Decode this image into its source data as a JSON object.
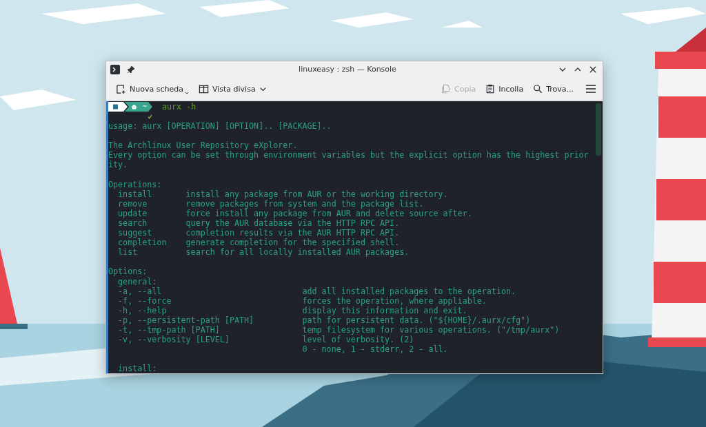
{
  "window": {
    "title": "linuxeasy : zsh — Konsole"
  },
  "toolbar": {
    "left": [
      {
        "label": "Nuova scheda",
        "kind": "newtab",
        "disabled": false
      },
      {
        "label": "Vista divisa",
        "kind": "split",
        "disabled": false
      }
    ],
    "right": [
      {
        "label": "Copia",
        "kind": "copy",
        "disabled": true
      },
      {
        "label": "Incolla",
        "kind": "paste",
        "disabled": false
      },
      {
        "label": "Trova...",
        "kind": "find",
        "disabled": false
      }
    ]
  },
  "prompt": {
    "dir": "~",
    "command": "aurx -h"
  },
  "terminal": [
    {
      "kind": "text",
      "text": "usage: aurx [OPERATION] [OPTION].. [PACKAGE].."
    },
    {
      "kind": "blank"
    },
    {
      "kind": "text",
      "text": "The Archlinux User Repository eXplorer."
    },
    {
      "kind": "text",
      "text": "Every option can be set through environment variables but the explicit option has the highest prior"
    },
    {
      "kind": "text",
      "text": "ity."
    },
    {
      "kind": "blank"
    },
    {
      "kind": "text",
      "text": "Operations:"
    },
    {
      "kind": "op",
      "term": "install",
      "desc": "install any package from AUR or the working directory."
    },
    {
      "kind": "op",
      "term": "remove",
      "desc": "remove packages from system and the package list."
    },
    {
      "kind": "op",
      "term": "update",
      "desc": "force install any package from AUR and delete source after."
    },
    {
      "kind": "op",
      "term": "search",
      "desc": "query the AUR database via the HTTP RPC API."
    },
    {
      "kind": "op",
      "term": "suggest",
      "desc": "completion results via the AUR HTTP RPC API."
    },
    {
      "kind": "op",
      "term": "completion",
      "desc": "generate completion for the specified shell."
    },
    {
      "kind": "op",
      "term": "list",
      "desc": "search for all locally installed AUR packages."
    },
    {
      "kind": "blank"
    },
    {
      "kind": "text",
      "text": "Options:"
    },
    {
      "kind": "sub",
      "text": "general:"
    },
    {
      "kind": "opt",
      "term": "-a, --all",
      "desc": "add all installed packages to the operation."
    },
    {
      "kind": "opt",
      "term": "-f, --force",
      "desc": "forces the operation, where appliable."
    },
    {
      "kind": "opt",
      "term": "-h, --help",
      "desc": "display this information and exit."
    },
    {
      "kind": "opt",
      "term": "-p, --persistent-path [PATH]",
      "desc": "path for persistent data. (\"${HOME}/.aurx/cfg\")"
    },
    {
      "kind": "opt",
      "term": "-t, --tmp-path [PATH]",
      "desc": "temp filesystem for various operations. (\"/tmp/aurx\")"
    },
    {
      "kind": "opt",
      "term": "-v, --verbosity [LEVEL]",
      "desc": "level of verbosity. (2)"
    },
    {
      "kind": "cont",
      "desc": "0 - none, 1 - stderr, 2 - all."
    },
    {
      "kind": "blank"
    },
    {
      "kind": "sub",
      "text": "install:"
    }
  ]
}
